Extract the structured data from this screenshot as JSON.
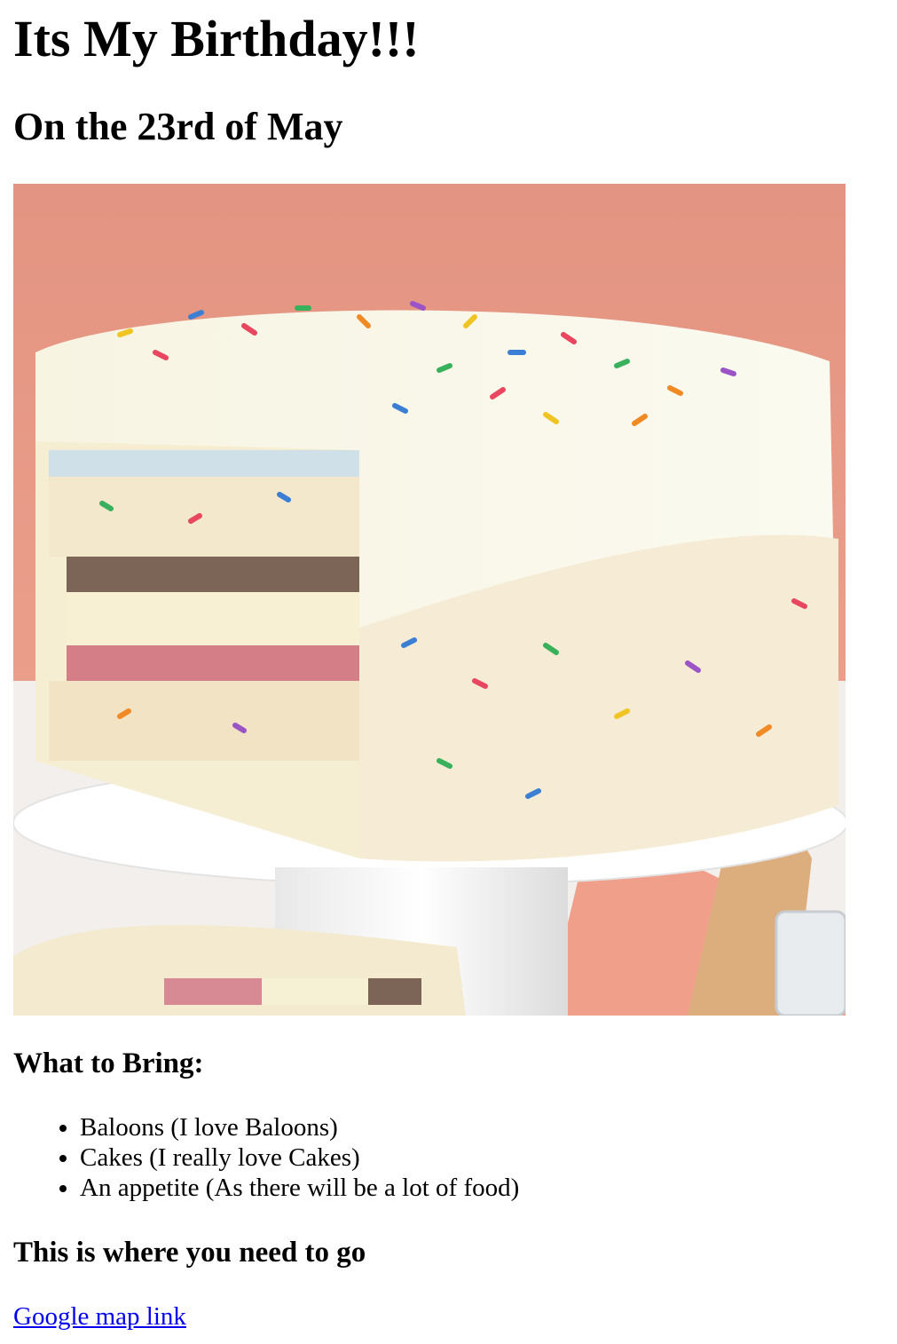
{
  "page": {
    "title": "Its My Birthday!!!",
    "date_heading": "On the 23rd of May"
  },
  "image": {
    "icon": "birthday-cake-photo"
  },
  "bring": {
    "heading": "What to Bring:",
    "items": [
      "Baloons (I love Baloons)",
      "Cakes (I really love Cakes)",
      "An appetite (As there will be a lot of food)"
    ]
  },
  "location": {
    "heading": "This is where you need to go",
    "link_text": "Google map link"
  },
  "colors": {
    "link": "#0000ee",
    "text": "#000000",
    "wall": "#e99a84",
    "frosting": "#f6f3df"
  }
}
